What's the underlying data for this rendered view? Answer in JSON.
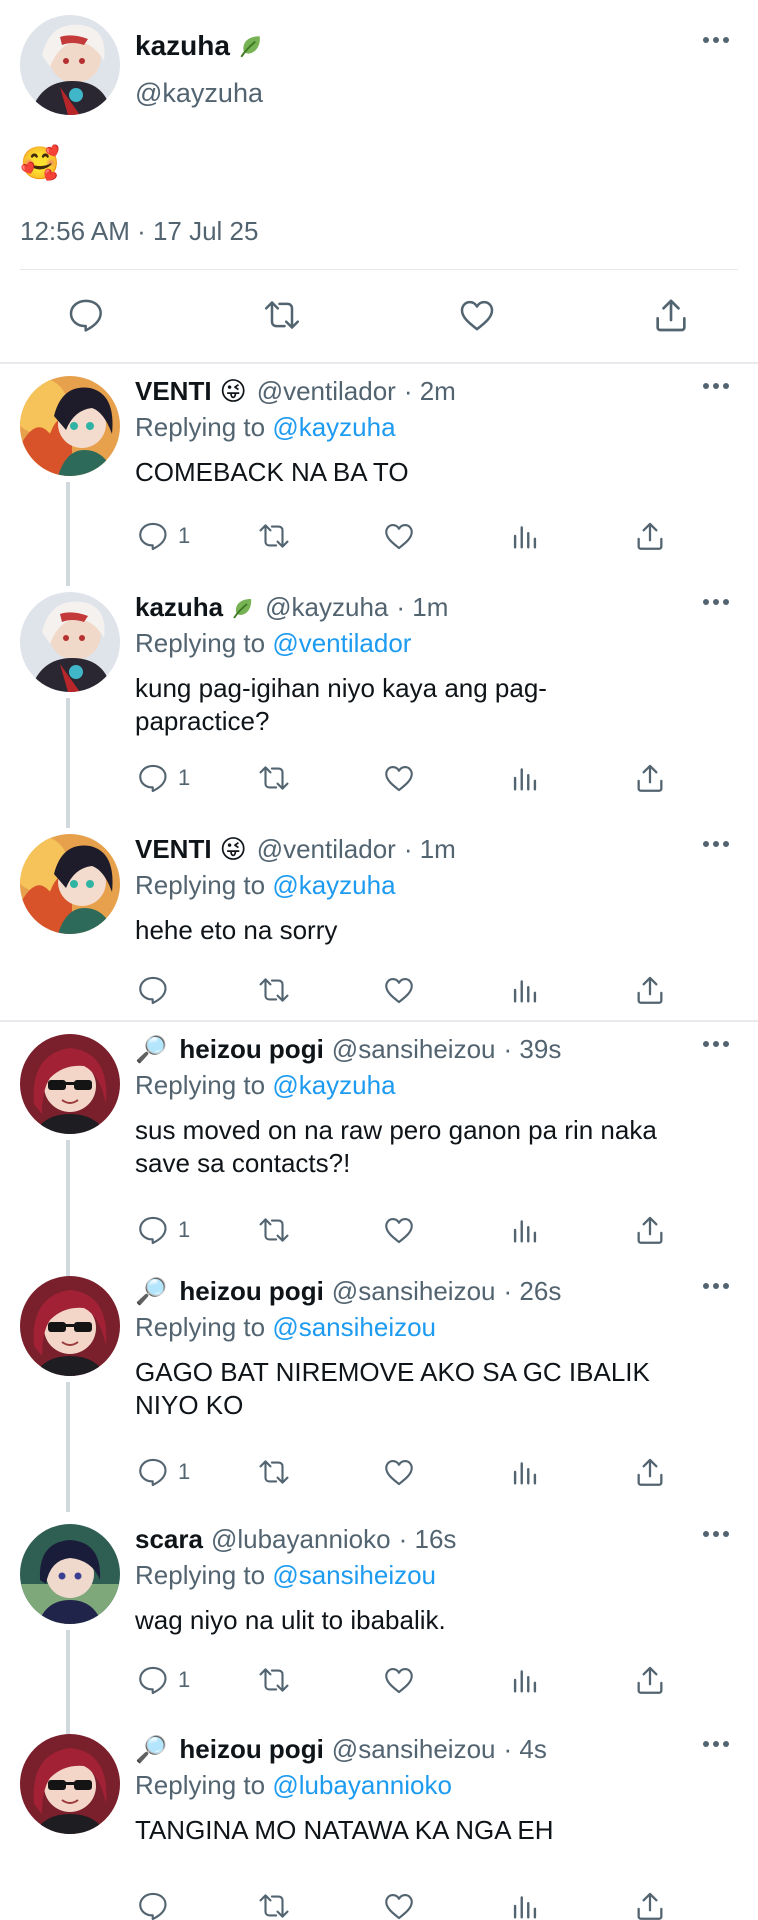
{
  "main_tweet": {
    "name": "kazuha",
    "handle": "@kayzuha",
    "text": "🥰",
    "timestamp": "12:56 AM · 17 Jul 25",
    "actions": [
      "reply-icon",
      "retweet-icon",
      "like-icon",
      "share-icon"
    ]
  },
  "replies": [
    {
      "name": "VENTI",
      "name_emoji": "😜",
      "handle": "@ventilador",
      "time": "· 2m",
      "replying_prefix": "Replying to",
      "replying_to": "@kayzuha",
      "text": "COMEBACK NA BA TO",
      "reply_count": "1"
    },
    {
      "name": "kazuha",
      "name_emoji": "leaf",
      "handle": "@kayzuha",
      "time": "· 1m",
      "replying_prefix": "Replying to",
      "replying_to": "@ventilador",
      "text": "kung pag-igihan niyo kaya ang pag-papractice?",
      "reply_count": "1"
    },
    {
      "name": "VENTI",
      "name_emoji": "😜",
      "handle": "@ventilador",
      "time": "· 1m",
      "replying_prefix": "Replying to",
      "replying_to": "@kayzuha",
      "text": "hehe eto na sorry",
      "reply_count": ""
    },
    {
      "name": "heizou pogi",
      "name_prefix": "🔎",
      "handle": "@sansiheizou",
      "time": "· 39s",
      "replying_prefix": "Replying to",
      "replying_to": "@kayzuha",
      "text": "sus moved on na raw pero ganon pa rin naka save sa contacts?!",
      "reply_count": "1"
    },
    {
      "name": "heizou pogi",
      "name_prefix": "🔎",
      "handle": "@sansiheizou",
      "time": "· 26s",
      "replying_prefix": "Replying to",
      "replying_to": "@sansiheizou",
      "text": "GAGO BAT NIREMOVE AKO SA GC IBALIK NIYO KO",
      "reply_count": "1"
    },
    {
      "name": "scara",
      "handle": "@lubayannioko",
      "time": "· 16s",
      "replying_prefix": "Replying to",
      "replying_to": "@sansiheizou",
      "text": "wag niyo na ulit to ibabalik.",
      "reply_count": "1"
    },
    {
      "name": "heizou pogi",
      "name_prefix": "🔎",
      "handle": "@sansiheizou",
      "time": "· 4s",
      "replying_prefix": "Replying to",
      "replying_to": "@lubayannioko",
      "text": "TANGINA MO NATAWA KA NGA EH",
      "reply_count": ""
    }
  ],
  "colors": {
    "link": "#1d9bf0",
    "secondary_text": "#536471",
    "icon": "#536471",
    "thread_line": "#cfd9de",
    "divider": "#e6e9ec"
  }
}
